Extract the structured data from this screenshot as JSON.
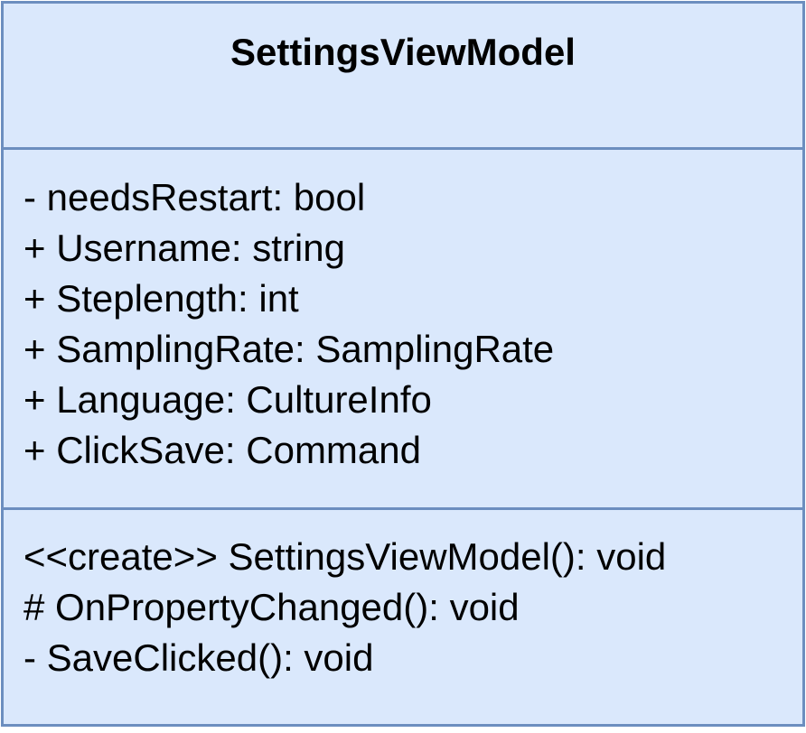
{
  "class": {
    "name": "SettingsViewModel",
    "attributes": [
      "- needsRestart: bool",
      "+ Username: string",
      "+ Steplength: int",
      "+ SamplingRate: SamplingRate",
      "+ Language: CultureInfo",
      "+ ClickSave: Command"
    ],
    "operations": [
      "<<create>> SettingsViewModel(): void",
      "# OnPropertyChanged(): void",
      "- SaveClicked(): void"
    ]
  },
  "colors": {
    "fill": "#dae8fc",
    "stroke": "#6c8ebf",
    "text": "#000000"
  }
}
